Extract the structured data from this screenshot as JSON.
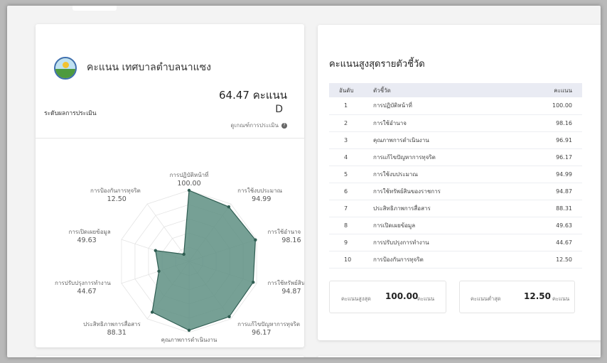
{
  "org": {
    "title": "คะแนน เทศบาลตำบลนาแซง",
    "score": "64.47 คะแนน",
    "level_label": "ระดับผลการประเมิน",
    "level_grade": "D",
    "criteria_link": "ดูเกณฑ์การประเมิน"
  },
  "ranking": {
    "title": "คะแนนสูงสุดรายตัวชี้วัด",
    "columns": [
      "อันดับ",
      "ตัวชี้วัด",
      "คะแนน"
    ],
    "rows": [
      {
        "rank": "1",
        "name": "การปฏิบัติหน้าที่",
        "score": "100.00"
      },
      {
        "rank": "2",
        "name": "การใช้อำนาจ",
        "score": "98.16"
      },
      {
        "rank": "3",
        "name": "คุณภาพการดำเนินงาน",
        "score": "96.91"
      },
      {
        "rank": "4",
        "name": "การแก้ไขปัญหาการทุจริต",
        "score": "96.17"
      },
      {
        "rank": "5",
        "name": "การใช้งบประมาณ",
        "score": "94.99"
      },
      {
        "rank": "6",
        "name": "การใช้ทรัพย์สินของราชการ",
        "score": "94.87"
      },
      {
        "rank": "7",
        "name": "ประสิทธิภาพการสื่อสาร",
        "score": "88.31"
      },
      {
        "rank": "8",
        "name": "การเปิดเผยข้อมูล",
        "score": "49.63"
      },
      {
        "rank": "9",
        "name": "การปรับปรุงการทำงาน",
        "score": "44.67"
      },
      {
        "rank": "10",
        "name": "การป้องกันการทุจริต",
        "score": "12.50"
      }
    ],
    "max_label": "คะแนนสูงสุด",
    "max_value": "100.00",
    "max_unit": "คะแนน",
    "min_label": "คะแนนต่ำสุด",
    "min_value": "12.50",
    "min_unit": "คะแนน"
  },
  "chart_data": {
    "type": "radar",
    "axes": [
      "การปฏิบัติหน้าที่",
      "การใช้งบประมาณ",
      "การใช้อำนาจ",
      "การใช้ทรัพย์สินฯ",
      "การแก้ไขปัญหาการทุจริต",
      "คุณภาพการดำเนินงาน",
      "ประสิทธิภาพการสื่อสาร",
      "การปรับปรุงการทำงาน",
      "การเปิดเผยข้อมูล",
      "การป้องกันการทุจริต"
    ],
    "values": [
      100.0,
      94.99,
      98.16,
      94.87,
      96.17,
      96.91,
      88.31,
      44.67,
      49.63,
      12.5
    ],
    "value_labels": [
      "100.00",
      "94.99",
      "98.16",
      "94.87",
      "96.17",
      "96.91",
      "88.31",
      "44.67",
      "49.63",
      "12.50"
    ],
    "range": [
      0,
      100
    ],
    "fill_color": "#5e8f82",
    "stroke_color": "#2f5d52"
  }
}
